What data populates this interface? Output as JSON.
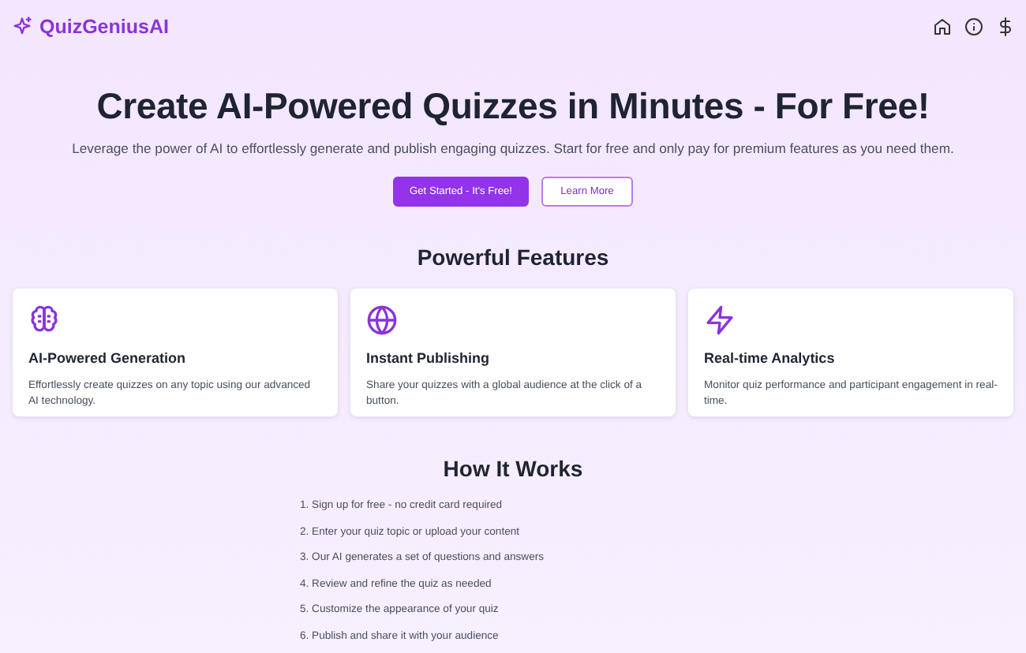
{
  "brand": "QuizGeniusAI",
  "hero": {
    "title": "Create AI-Powered Quizzes in Minutes - For Free!",
    "subtitle": "Leverage the power of AI to effortlessly generate and publish engaging quizzes. Start for free and only pay for premium features as you need them.",
    "buttons": [
      {
        "label": "Get Started - It's Free!",
        "kind": "primary"
      },
      {
        "label": "Learn More",
        "kind": "outline"
      }
    ]
  },
  "features": {
    "title": "Powerful Features",
    "items": [
      {
        "kind": "brain",
        "title": "AI-Powered Generation",
        "text": "Effortlessly create quizzes on any topic using our advanced AI technology."
      },
      {
        "kind": "globe",
        "title": "Instant Publishing",
        "text": "Share your quizzes with a global audience at the click of a button."
      },
      {
        "kind": "zap",
        "title": "Real-time Analytics",
        "text": "Monitor quiz performance and participant engagement in real-time."
      }
    ]
  },
  "how_it_works": {
    "title": "How It Works",
    "steps": [
      "1. Sign up for free - no credit card required",
      "2. Enter your quiz topic or upload your content",
      "3. Our AI generates a set of questions and answers",
      "4. Review and refine the quiz as needed",
      "5. Customize the appearance of your quiz",
      "6. Publish and share it with your audience"
    ]
  }
}
